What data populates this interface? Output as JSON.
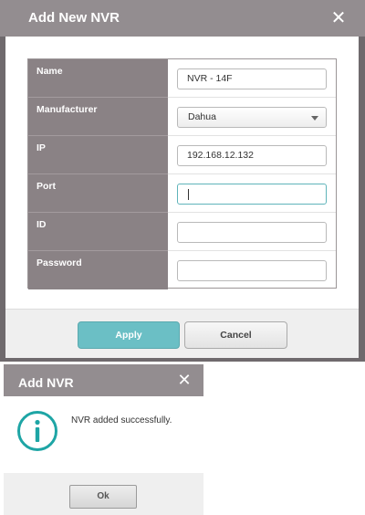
{
  "add_dialog": {
    "title": "Add New NVR",
    "close_glyph": "✕",
    "fields": [
      {
        "label": "Name",
        "type": "text",
        "value": "NVR - 14F"
      },
      {
        "label": "Manufacturer",
        "type": "select",
        "value": "Dahua"
      },
      {
        "label": "IP",
        "type": "text",
        "value": "192.168.12.132"
      },
      {
        "label": "Port",
        "type": "text",
        "value": "",
        "focused": true
      },
      {
        "label": "ID",
        "type": "text",
        "value": ""
      },
      {
        "label": "Password",
        "type": "password",
        "value": ""
      }
    ],
    "apply_label": "Apply",
    "cancel_label": "Cancel"
  },
  "result_dialog": {
    "title": "Add NVR",
    "close_glyph": "✕",
    "icon": "info-icon",
    "message": "NVR added successfully.",
    "ok_label": "Ok"
  },
  "colors": {
    "titlebar": "#938d90",
    "label_cell": "#8a8285",
    "accent": "#6bbfc5",
    "info_icon": "#1ea5a5"
  }
}
